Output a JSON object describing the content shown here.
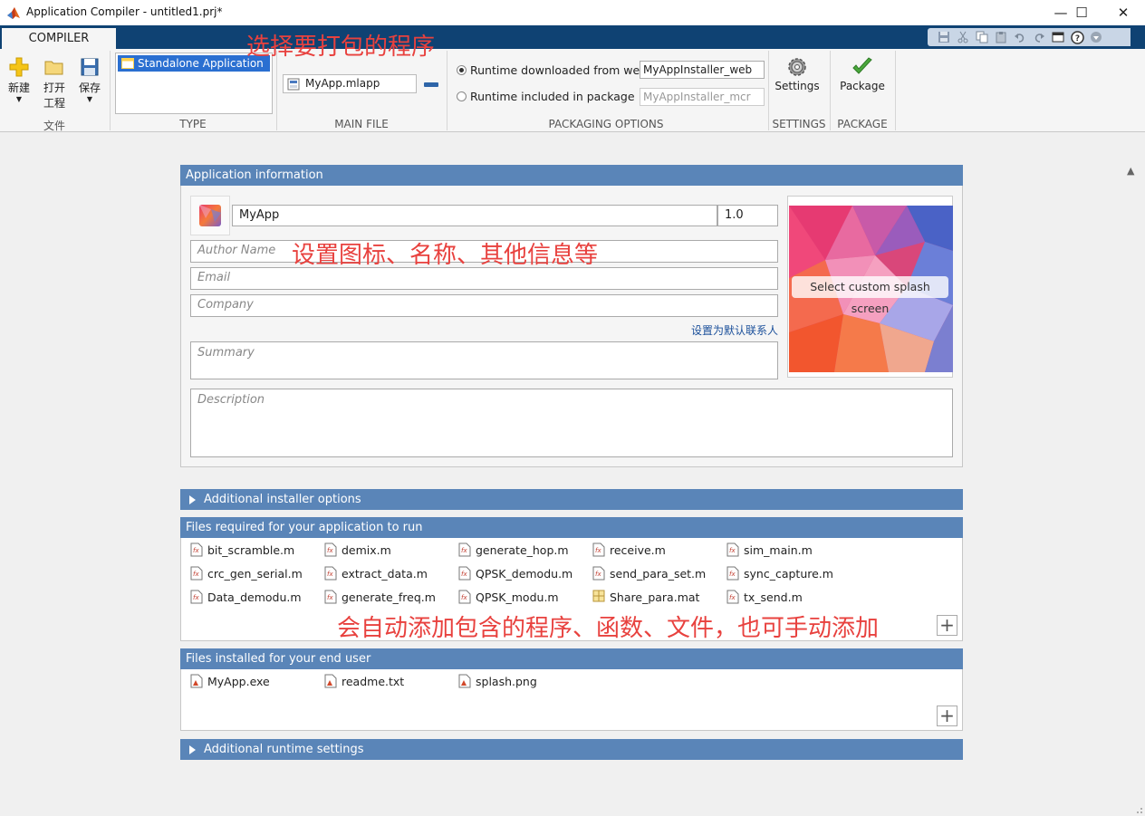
{
  "window": {
    "title": "Application Compiler - untitled1.prj*",
    "minimize_glyph": "—",
    "maximize_glyph": "☐",
    "close_glyph": "✕"
  },
  "ribbon": {
    "tab_label": "COMPILER",
    "file_section": {
      "label": "文件",
      "new_label": "新建",
      "open_label_1": "打开",
      "open_label_2": "工程",
      "save_label": "保存"
    },
    "type_section": {
      "label": "TYPE",
      "selected_type": "Standalone Application"
    },
    "main_file_section": {
      "label": "MAIN FILE",
      "file_name": "MyApp.mlapp"
    },
    "packaging_options": {
      "label": "PACKAGING OPTIONS",
      "option_web_label": "Runtime downloaded from web",
      "option_web_value": "MyAppInstaller_web",
      "option_web_selected": true,
      "option_pkg_label": "Runtime included in package",
      "option_pkg_value": "MyAppInstaller_mcr",
      "option_pkg_selected": false
    },
    "settings_section": {
      "label": "SETTINGS",
      "button_label": "Settings"
    },
    "package_section": {
      "label": "PACKAGE",
      "button_label": "Package"
    },
    "quick_access_icons": [
      "save-icon",
      "cut-icon",
      "copy-icon",
      "paste-icon",
      "undo-icon",
      "redo-icon",
      "window-icon",
      "help-icon",
      "dropdown-icon"
    ]
  },
  "annotations": {
    "choose_program": "选择要打包的程序",
    "set_icon_info": "设置图标、名称、其他信息等",
    "auto_add_files": "会自动添加包含的程序、函数、文件，也可手动添加"
  },
  "app_info": {
    "header": "Application information",
    "app_name": "MyApp",
    "version": "1.0",
    "author_placeholder": "Author Name",
    "email_placeholder": "Email",
    "company_placeholder": "Company",
    "set_default_contact": "设置为默认联系人",
    "summary_placeholder": "Summary",
    "description_placeholder": "Description",
    "splash_button": "Select custom splash screen"
  },
  "additional_installer_options": "Additional installer options",
  "files_required": {
    "header": "Files required for your application to run",
    "files": [
      "bit_scramble.m",
      "demix.m",
      "generate_hop.m",
      "receive.m",
      "sim_main.m",
      "crc_gen_serial.m",
      "extract_data.m",
      "QPSK_demodu.m",
      "send_para_set.m",
      "sync_capture.m",
      "Data_demodu.m",
      "generate_freq.m",
      "QPSK_modu.m",
      "Share_para.mat",
      "tx_send.m"
    ],
    "add_glyph": "+"
  },
  "files_installed": {
    "header": "Files installed for your end user",
    "files": [
      "MyApp.exe",
      "readme.txt",
      "splash.png"
    ],
    "add_glyph": "+"
  },
  "additional_runtime_settings": "Additional runtime settings",
  "colors": {
    "ribbon_bar": "#0f4273",
    "panel_header": "#5a85b8",
    "selection": "#2a6fd1",
    "annotation": "#e8413e",
    "link": "#1a4f9a"
  }
}
